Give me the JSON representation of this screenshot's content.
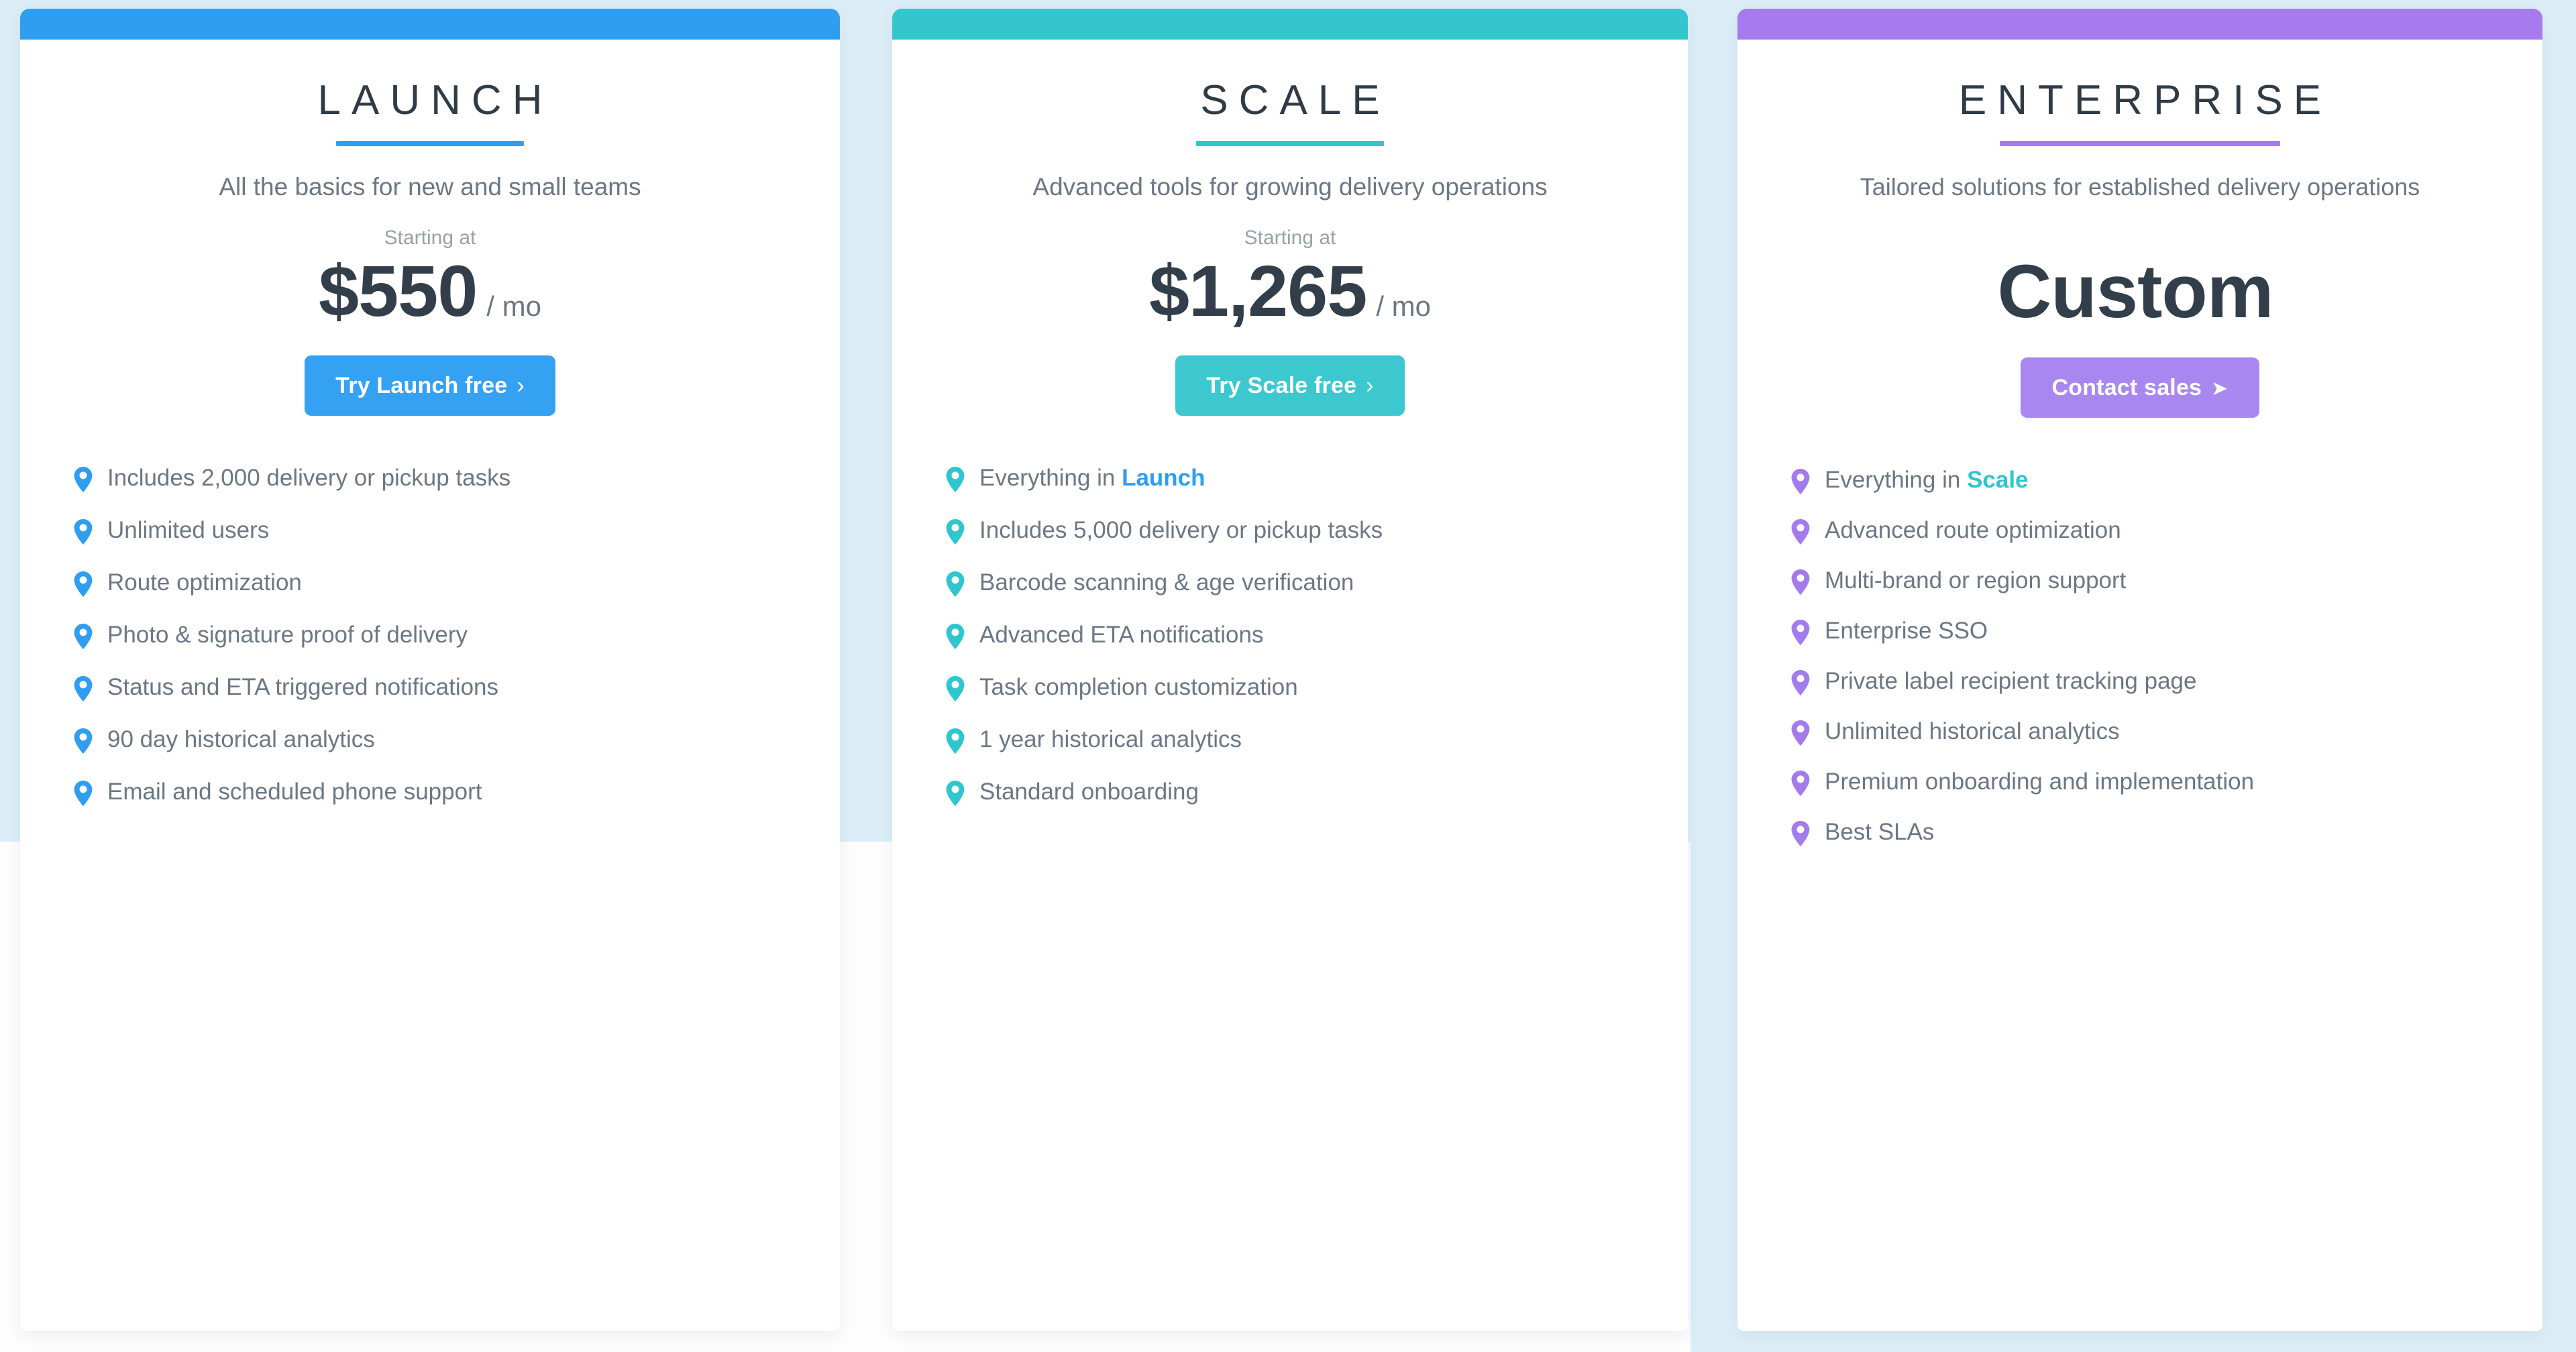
{
  "theme": {
    "page_background": "#ffffff",
    "band_background": "#dbeef8",
    "card_background": "#ffffff",
    "heading_color": "#2f3b46",
    "body_text_color": "#6b7785",
    "muted_text_color": "#97a2ad"
  },
  "plans": [
    {
      "name": "LAUNCH",
      "accent": "#2f9ef0",
      "topbar_color": "#2f9ef0",
      "rule_color": "#2f9ef0",
      "tagline": "All the basics for new and small teams",
      "price_prefix": "Starting at",
      "price": "$550",
      "price_period": "/ mo",
      "cta_label": "Try Launch free",
      "cta_arrow": "›",
      "cta_arrow_icon": "chevron-right-icon",
      "cta_color": "#35a1f2",
      "features": [
        {
          "text": "Includes 2,000 delivery or pickup tasks"
        },
        {
          "text": "Unlimited users"
        },
        {
          "text": "Route optimization"
        },
        {
          "text": "Photo & signature proof of delivery"
        },
        {
          "text": "Status and ETA triggered notifications"
        },
        {
          "text": "90 day historical analytics"
        },
        {
          "text": "Email and scheduled phone support"
        }
      ]
    },
    {
      "name": "SCALE",
      "accent": "#2fc6ce",
      "topbar_color": "#34c6cd",
      "rule_color": "#2fc6ce",
      "tagline": "Advanced tools for growing delivery operations",
      "price_prefix": "Starting at",
      "price": "$1,265",
      "price_period": "/ mo",
      "cta_label": "Try Scale free",
      "cta_arrow": "›",
      "cta_arrow_icon": "chevron-right-icon",
      "cta_color": "#3cc8ce",
      "features": [
        {
          "text": "Everything in ",
          "highlight": "Launch",
          "highlight_color": "#2f9ef0"
        },
        {
          "text": "Includes 5,000 delivery or pickup tasks"
        },
        {
          "text": "Barcode scanning & age verification"
        },
        {
          "text": "Advanced ETA notifications"
        },
        {
          "text": "Task completion customization"
        },
        {
          "text": "1 year historical analytics"
        },
        {
          "text": "Standard onboarding"
        }
      ]
    },
    {
      "name": "ENTERPRISE",
      "accent": "#a47bee",
      "topbar_color": "#a77bef",
      "rule_color": "#a47bee",
      "tagline": "Tailored solutions for established delivery operations",
      "price_prefix": "",
      "price": "Custom",
      "price_period": "",
      "cta_label": "Contact sales",
      "cta_arrow": "➤",
      "cta_arrow_icon": "send-arrow-icon",
      "cta_color": "#a888f0",
      "features": [
        {
          "text": "Everything in ",
          "highlight": "Scale",
          "highlight_color": "#2fc6ce"
        },
        {
          "text": "Advanced route optimization"
        },
        {
          "text": "Multi-brand or region support"
        },
        {
          "text": "Enterprise SSO"
        },
        {
          "text": "Private label recipient tracking page"
        },
        {
          "text": "Unlimited historical analytics"
        },
        {
          "text": "Premium onboarding and implementation"
        },
        {
          "text": "Best SLAs"
        }
      ]
    }
  ]
}
